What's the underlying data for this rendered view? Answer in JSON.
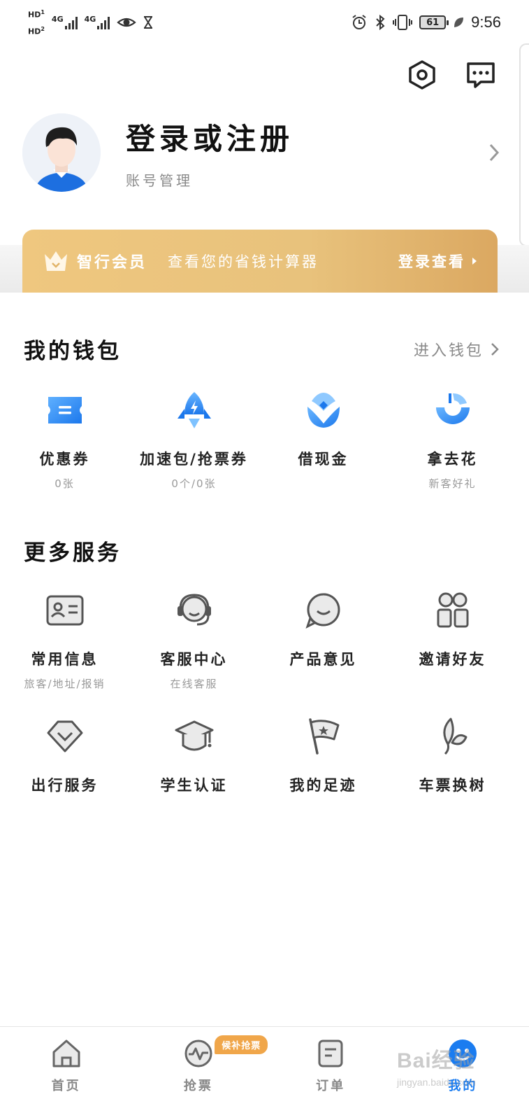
{
  "status_bar": {
    "hd1": "HD",
    "hd1_sub": "1",
    "hd2": "HD",
    "hd2_sub": "2",
    "net1": "4G",
    "net2": "4G",
    "battery": "61",
    "time": "9:56"
  },
  "header": {
    "settings_icon": "hexagon-settings-icon",
    "message_icon": "message-icon"
  },
  "profile": {
    "title": "登录或注册",
    "subtitle": "账号管理"
  },
  "vip": {
    "label": "智行会员",
    "description": "查看您的省钱计算器",
    "action": "登录查看"
  },
  "wallet": {
    "title": "我的钱包",
    "link": "进入钱包",
    "items": [
      {
        "label": "优惠券",
        "sub": "0张",
        "icon": "coupon-icon",
        "color": "#2f8cf5"
      },
      {
        "label": "加速包/抢票券",
        "sub": "0个/0张",
        "icon": "rocket-icon",
        "color": "#2f8cf5"
      },
      {
        "label": "借现金",
        "sub": "",
        "icon": "cash-icon",
        "color": "#2f8cf5"
      },
      {
        "label": "拿去花",
        "sub": "新客好礼",
        "icon": "spend-icon",
        "color": "#2f8cf5"
      }
    ]
  },
  "services": {
    "title": "更多服务",
    "items": [
      {
        "label": "常用信息",
        "sub": "旅客/地址/报销",
        "icon": "id-card-icon"
      },
      {
        "label": "客服中心",
        "sub": "在线客服",
        "icon": "headset-icon"
      },
      {
        "label": "产品意见",
        "sub": "",
        "icon": "feedback-icon"
      },
      {
        "label": "邀请好友",
        "sub": "",
        "icon": "invite-friends-icon"
      },
      {
        "label": "出行服务",
        "sub": "",
        "icon": "travel-service-icon"
      },
      {
        "label": "学生认证",
        "sub": "",
        "icon": "graduation-cap-icon"
      },
      {
        "label": "我的足迹",
        "sub": "",
        "icon": "footprint-flag-icon"
      },
      {
        "label": "车票换树",
        "sub": "",
        "icon": "tree-leaf-icon"
      }
    ]
  },
  "tab_bar": {
    "tabs": [
      {
        "label": "首页",
        "icon": "home-icon"
      },
      {
        "label": "抢票",
        "icon": "grab-ticket-icon",
        "badge": "候补抢票"
      },
      {
        "label": "订单",
        "icon": "order-icon"
      },
      {
        "label": "我的",
        "icon": "profile-tab-icon"
      }
    ],
    "active_index": 3,
    "active_color": "#1a7cf0"
  },
  "watermark": {
    "text": "Bai经验",
    "sub": "jingyan.baidu.com"
  }
}
